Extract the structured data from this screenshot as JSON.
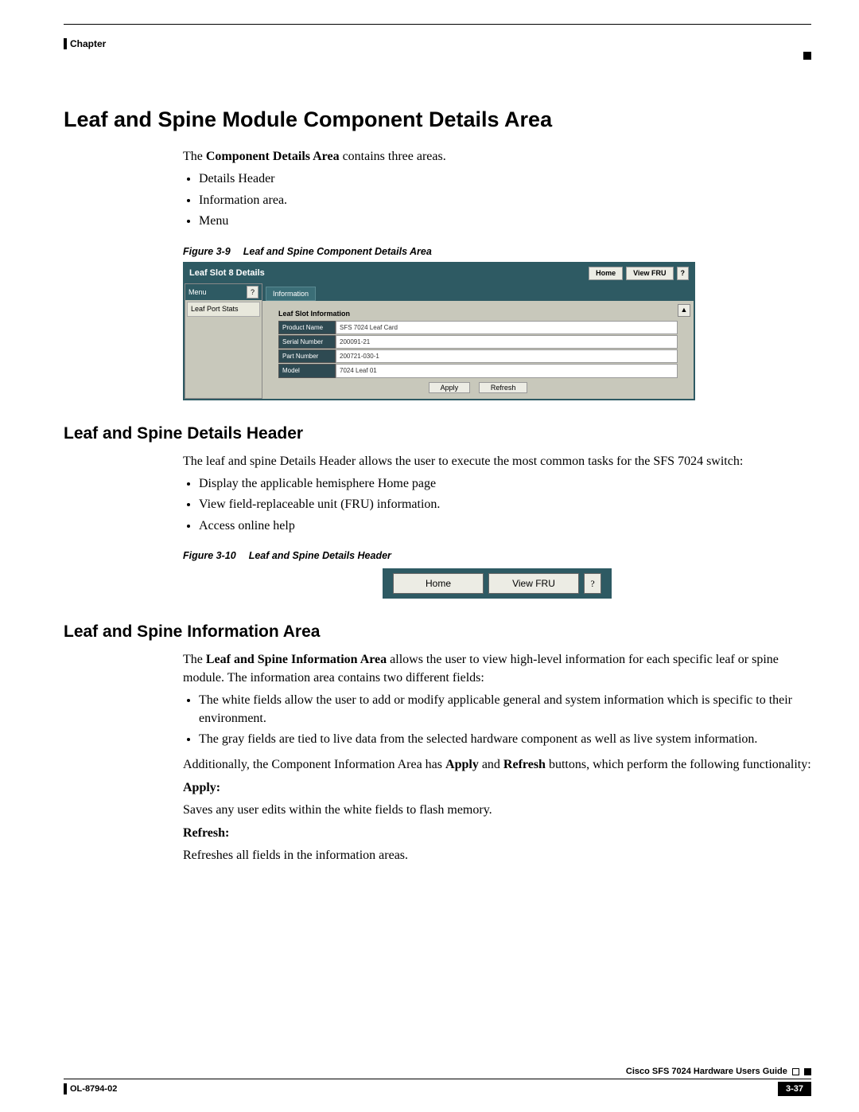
{
  "header": {
    "chapter_label": "Chapter"
  },
  "title": "Leaf and Spine Module Component Details Area",
  "intro": {
    "prefix": "The ",
    "bold": "Component Details Area",
    "suffix": " contains three areas.",
    "bullets": [
      "Details Header",
      "Information area.",
      "Menu"
    ]
  },
  "fig39": {
    "caption_num": "Figure 3-9",
    "caption_title": "Leaf and Spine Component Details Area",
    "slot_title": "Leaf Slot 8 Details",
    "home": "Home",
    "viewfru": "View FRU",
    "q": "?",
    "menu_label": "Menu",
    "menu_item": "Leaf Port Stats",
    "tab": "Information",
    "box_title": "Leaf Slot Information",
    "rows": [
      {
        "label": "Product Name",
        "val": "SFS 7024 Leaf Card"
      },
      {
        "label": "Serial Number",
        "val": "200091-21"
      },
      {
        "label": "Part Number",
        "val": "200721-030-1"
      },
      {
        "label": "Model",
        "val": "7024 Leaf 01"
      }
    ],
    "apply": "Apply",
    "refresh": "Refresh"
  },
  "sec_details": {
    "title": "Leaf and Spine Details Header",
    "para": "The leaf and spine Details Header allows the user to execute the most common tasks for the SFS 7024 switch:",
    "bullets": [
      "Display the applicable hemisphere Home page",
      "View field-replaceable unit (FRU) information.",
      "Access online help"
    ]
  },
  "fig310": {
    "caption_num": "Figure 3-10",
    "caption_title": "Leaf and Spine Details Header",
    "home": "Home",
    "viewfru": "View FRU",
    "q": "?"
  },
  "sec_info": {
    "title": "Leaf and Spine Information Area",
    "para1_pre": "The ",
    "para1_bold": "Leaf and Spine Information Area",
    "para1_post": " allows the user to view high-level information for each specific leaf or spine module. The information area contains two different fields:",
    "bullets": [
      "The white fields allow the user to add or modify applicable general and system information which is specific to their environment.",
      "The gray fields are tied to live data from the selected hardware component as well as live system information."
    ],
    "para2_pre": "Additionally, the Component Information Area has ",
    "para2_b1": "Apply",
    "para2_mid": " and ",
    "para2_b2": "Refresh",
    "para2_post": " buttons, which perform the following functionality:",
    "apply_label": "Apply:",
    "apply_text": "Saves any user edits within the white fields to flash memory.",
    "refresh_label": "Refresh:",
    "refresh_text": "Refreshes all fields in the information areas."
  },
  "footer": {
    "guide": "Cisco SFS 7024 Hardware Users Guide",
    "doc": "OL-8794-02",
    "page": "3-37"
  }
}
